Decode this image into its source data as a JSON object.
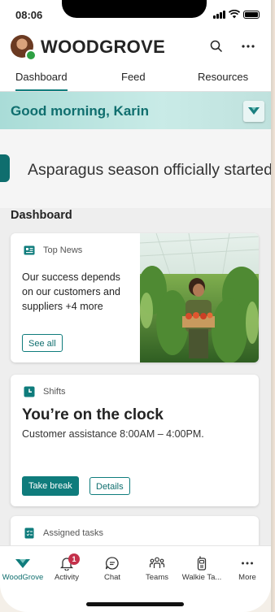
{
  "status_bar": {
    "time": "08:06"
  },
  "header": {
    "brand": "WOODGROVE"
  },
  "tabs": [
    {
      "label": "Dashboard",
      "active": true
    },
    {
      "label": "Feed",
      "active": false
    },
    {
      "label": "Resources",
      "active": false
    }
  ],
  "greeting": {
    "text": "Good morning, Karin"
  },
  "announcement": {
    "text": "Asparagus season officially started"
  },
  "dashboard": {
    "title": "Dashboard",
    "top_news": {
      "heading": "Top News",
      "body": "Our success depends on our customers and suppliers +4 more",
      "see_all": "See all"
    },
    "shifts": {
      "heading": "Shifts",
      "title": "You’re on the clock",
      "subtitle": "Customer assistance 8:00AM – 4:00PM.",
      "take_break": "Take break",
      "details": "Details"
    },
    "assigned_tasks": {
      "heading": "Assigned tasks"
    }
  },
  "bottom_nav": [
    {
      "label": "WoodGrove",
      "icon": "woodgrove-icon",
      "active": true
    },
    {
      "label": "Activity",
      "icon": "bell-icon",
      "badge": "1"
    },
    {
      "label": "Chat",
      "icon": "chat-icon"
    },
    {
      "label": "Teams",
      "icon": "teams-icon"
    },
    {
      "label": "Walkie Ta...",
      "icon": "walkie-talkie-icon"
    },
    {
      "label": "More",
      "icon": "more-icon"
    }
  ],
  "colors": {
    "accent": "#0f7c7c",
    "greeting_bg": "#b9e3df",
    "badge": "#c4314b"
  }
}
